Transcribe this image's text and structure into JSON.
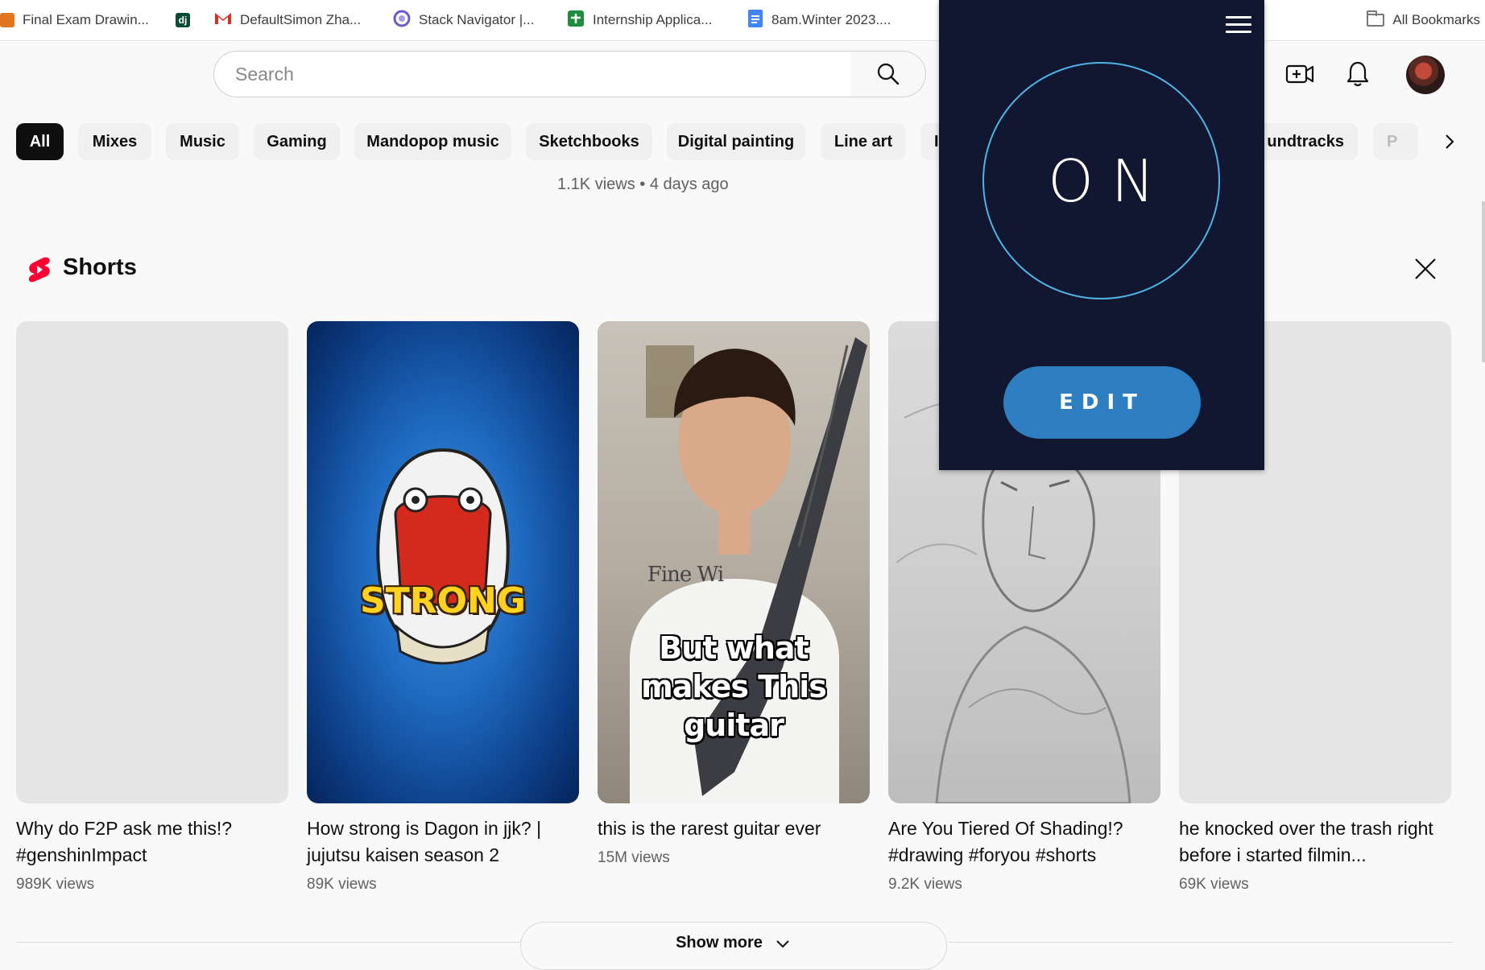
{
  "bookmarks": [
    {
      "label": "Final Exam Drawin...",
      "color": "#e0761f"
    },
    {
      "label": "",
      "badge": "dj",
      "color": "#0c4b33"
    },
    {
      "label": "DefaultSimon Zha...",
      "color": "#d93025"
    },
    {
      "label": "Stack Navigator |...",
      "color": "#6a5acd"
    },
    {
      "label": "Internship Applica...",
      "color": "#1e8e3e"
    },
    {
      "label": "8am.Winter 2023....",
      "color": "#4285f4"
    }
  ],
  "all_bookmarks_label": "All Bookmarks",
  "search": {
    "placeholder": "Search"
  },
  "chips": [
    "All",
    "Mixes",
    "Music",
    "Gaming",
    "Mandopop music",
    "Sketchbooks",
    "Digital painting",
    "Line art",
    "I",
    "undtracks",
    "P"
  ],
  "meta_line": "1.1K views • 4 days ago",
  "shorts": {
    "title": "Shorts",
    "items": [
      {
        "title": "Why do F2P ask me this!? #genshinImpact",
        "views": "989K views"
      },
      {
        "title": "How strong is Dagon in jjk? | jujutsu kaisen season 2",
        "views": "89K views",
        "overlay": "STRONG"
      },
      {
        "title": "this is the rarest guitar ever",
        "views": "15M views",
        "overlay": "But what makes This guitar",
        "shirt": "Fine Wi"
      },
      {
        "title": "Are You Tiered Of Shading!? #drawing #foryou #shorts",
        "views": "9.2K views"
      },
      {
        "title": "he knocked over the trash right before i started filmin...",
        "views": "69K views"
      }
    ]
  },
  "show_more": "Show more",
  "panel": {
    "status": "ON",
    "edit_label": "EDIT",
    "ring_color": "#4fb3e6",
    "button_color": "#2e7fc1",
    "bg_color": "#111631"
  }
}
